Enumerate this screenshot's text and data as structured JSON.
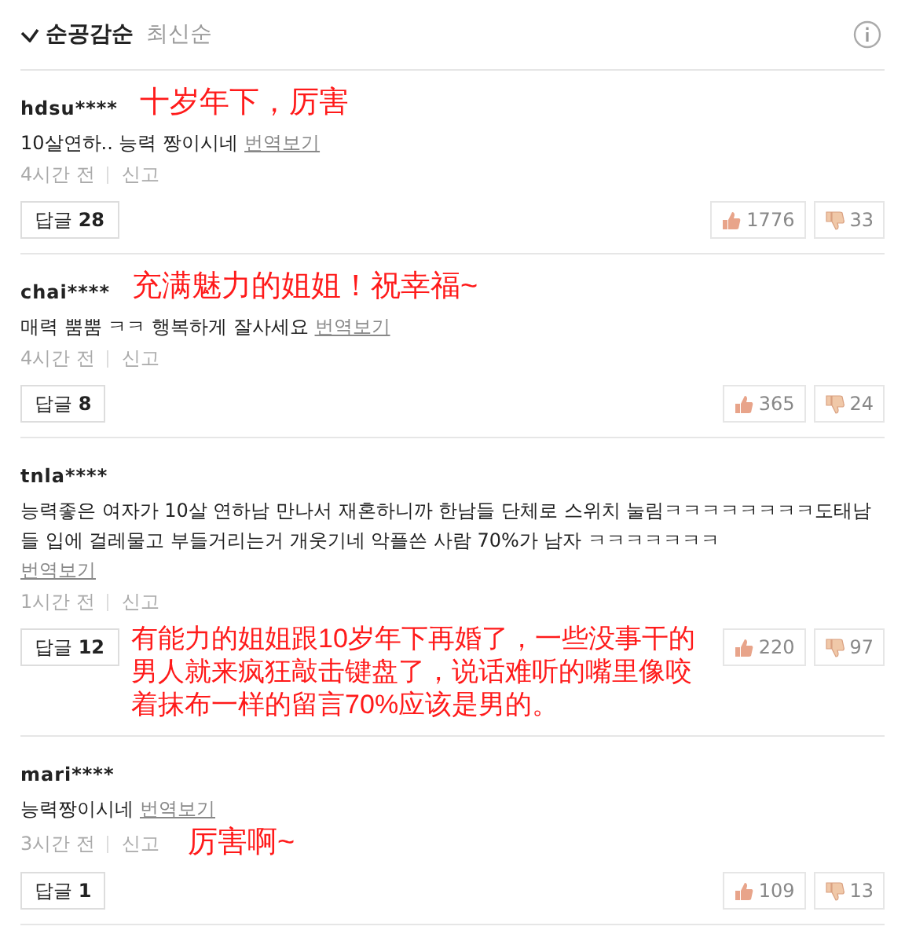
{
  "sort_tabs": [
    {
      "label": "순공감순",
      "selected": true
    },
    {
      "label": "최신순",
      "selected": false
    }
  ],
  "comments": [
    {
      "user": "hdsu****",
      "text": "10살연하.. 능력 짱이시네",
      "translate": "번역보기",
      "time": "4시간 전",
      "report": "신고",
      "replies_label": "답글",
      "replies": "28",
      "likes": "1776",
      "dislikes": "33",
      "annotation": {
        "kind": "inline",
        "text": "十岁年下，厉害"
      }
    },
    {
      "user": "chai****",
      "text": "매력 뿜뿜 ㅋㅋ 행복하게 잘사세요",
      "translate": "번역보기",
      "time": "4시간 전",
      "report": "신고",
      "replies_label": "답글",
      "replies": "8",
      "likes": "365",
      "dislikes": "24",
      "annotation": {
        "kind": "inline",
        "text": "充满魅力的姐姐！祝幸福~"
      }
    },
    {
      "user": "tnla****",
      "text": "능력좋은 여자가 10살 연하남 만나서 재혼하니까 한남들 단체로 스위치 눌림ㅋㅋㅋㅋㅋㅋㅋㅋ도태남들 입에 걸레물고 부들거리는거 개웃기네 악플쓴 사람 70%가 남자 ㅋㅋㅋㅋㅋㅋㅋ",
      "translate": "번역보기",
      "time": "1시간 전",
      "report": "신고",
      "replies_label": "답글",
      "replies": "12",
      "likes": "220",
      "dislikes": "97",
      "annotation": {
        "kind": "button-row",
        "text": "有能力的姐姐跟10岁年下再婚了，一些没事干的男人就来疯狂敲击键盘了，说话难听的嘴里像咬着抹布一样的留言70%应该是男的。"
      }
    },
    {
      "user": "mari****",
      "text": "능력짱이시네",
      "translate": "번역보기",
      "time": "3시간 전",
      "report": "신고",
      "replies_label": "답글",
      "replies": "1",
      "likes": "109",
      "dislikes": "13",
      "annotation": {
        "kind": "meta-row",
        "text": "厉害啊~"
      }
    }
  ]
}
